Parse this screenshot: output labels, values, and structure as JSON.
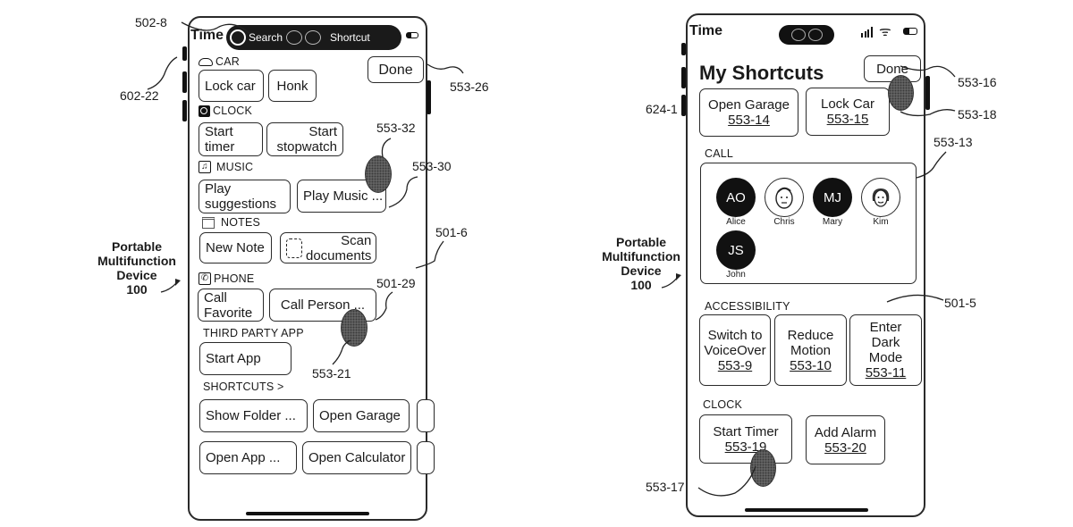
{
  "left_device": {
    "status": {
      "time": "Time",
      "search_label": "Search",
      "shortcut_label": "Shortcut"
    },
    "done_label": "Done",
    "sections": {
      "car": {
        "title": "CAR",
        "buttons": [
          "Lock car",
          "Honk"
        ]
      },
      "clock": {
        "title": "CLOCK",
        "buttons": [
          [
            "Start",
            "timer"
          ],
          [
            "Start",
            "stopwatch"
          ]
        ]
      },
      "music": {
        "title": "MUSIC",
        "buttons": [
          [
            "Play",
            "suggestions"
          ],
          "Play Music ..."
        ]
      },
      "notes": {
        "title": "NOTES",
        "buttons": [
          "New Note",
          [
            "Scan",
            "documents"
          ]
        ]
      },
      "phone": {
        "title": "PHONE",
        "buttons": [
          [
            "Call",
            "Favorite"
          ],
          "Call Person ..."
        ]
      },
      "third_party": {
        "title": "THIRD PARTY APP",
        "buttons": [
          "Start App"
        ]
      },
      "shortcuts": {
        "title": "SHORTCUTS >",
        "buttons": [
          "Show Folder ...",
          "Open Garage",
          "Open App ...",
          "Open Calculator"
        ]
      }
    },
    "caption": [
      "Portable",
      "Multifunction",
      "Device",
      "100"
    ],
    "refs": {
      "r502_8": "502-8",
      "r602_22": "602-22",
      "r553_26": "553-26",
      "r553_32": "553-32",
      "r553_30": "553-30",
      "r501_6": "501-6",
      "r501_29": "501-29",
      "r553_21": "553-21"
    }
  },
  "right_device": {
    "status": {
      "time": "Time"
    },
    "title": "My Shortcuts",
    "done_label": "Done",
    "top_buttons": [
      {
        "label": "Open Garage",
        "ref": "553-14"
      },
      {
        "label": "Lock Car",
        "ref": "553-15"
      }
    ],
    "call": {
      "title": "CALL",
      "contacts": [
        {
          "initials": "AO",
          "name": "Alice",
          "style": "dark"
        },
        {
          "initials": "",
          "name": "Chris",
          "style": "face"
        },
        {
          "initials": "MJ",
          "name": "Mary",
          "style": "dark"
        },
        {
          "initials": "",
          "name": "Kim",
          "style": "face"
        },
        {
          "initials": "JS",
          "name": "John",
          "style": "dark"
        }
      ]
    },
    "accessibility": {
      "title": "ACCESSIBILITY",
      "buttons": [
        {
          "lines": [
            "Switch to",
            "VoiceOver"
          ],
          "ref": "553-9"
        },
        {
          "lines": [
            "Reduce",
            "Motion"
          ],
          "ref": "553-10"
        },
        {
          "lines": [
            "Enter",
            "Dark",
            "Mode"
          ],
          "ref": "553-11"
        }
      ]
    },
    "clock": {
      "title": "CLOCK",
      "buttons": [
        {
          "label": "Start Timer",
          "ref": "553-19"
        },
        {
          "label": "Add Alarm",
          "ref": "553-20"
        }
      ]
    },
    "caption": [
      "Portable",
      "Multifunction",
      "Device",
      "100"
    ],
    "refs": {
      "r624_1": "624-1",
      "r553_16": "553-16",
      "r553_18": "553-18",
      "r553_13": "553-13",
      "r501_5": "501-5",
      "r553_17": "553-17"
    }
  }
}
